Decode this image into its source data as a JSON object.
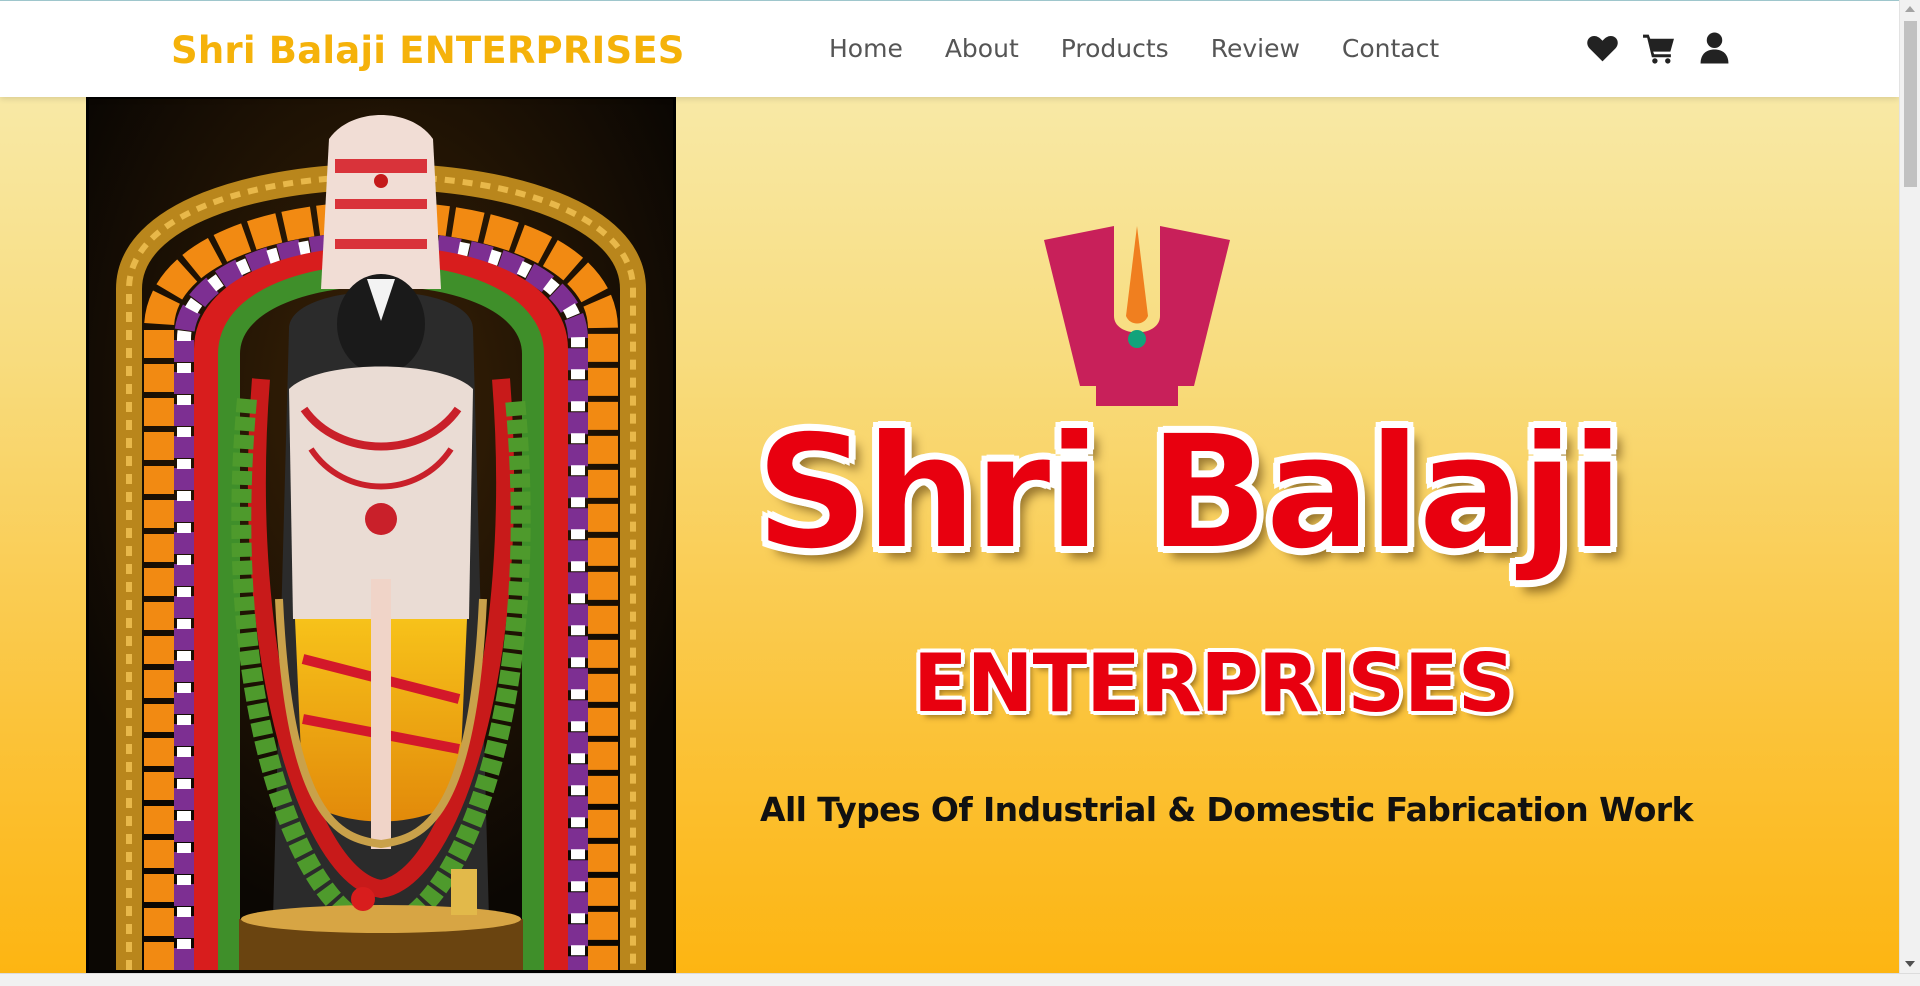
{
  "header": {
    "brand": "Shri Balaji ENTERPRISES",
    "brand_color": "#f5b20a",
    "nav": [
      {
        "label": "Home"
      },
      {
        "label": "About"
      },
      {
        "label": "Products"
      },
      {
        "label": "Review"
      },
      {
        "label": "Contact"
      }
    ],
    "icons": [
      "heart-icon",
      "cart-icon",
      "user-icon"
    ]
  },
  "hero": {
    "title": "Shri Balaji",
    "subtitle": "ENTERPRISES",
    "tagline": "All Types Of Industrial & Domestic Fabrication Work",
    "title_color": "#e8000f",
    "background_colors": [
      "#f8e9a6",
      "#fdb512"
    ]
  }
}
